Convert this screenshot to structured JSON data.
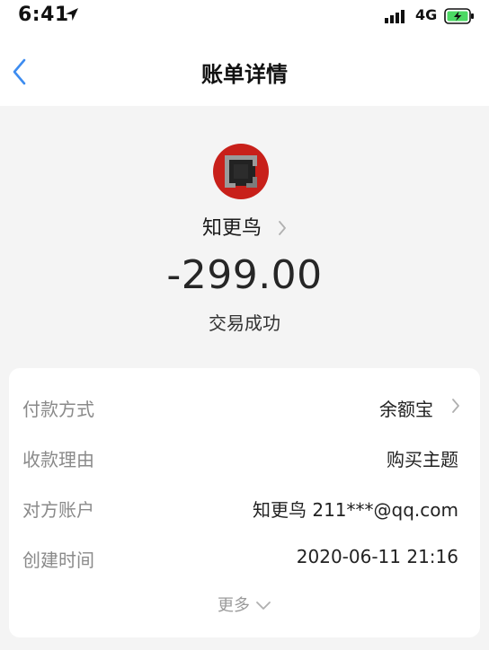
{
  "status_bar": {
    "time": "6:41",
    "network": "4G"
  },
  "nav": {
    "title": "账单详情"
  },
  "transaction": {
    "merchant": "知更鸟",
    "amount": "-299.00",
    "status": "交易成功"
  },
  "details": {
    "rows": [
      {
        "label": "付款方式",
        "value": "余额宝"
      },
      {
        "label": "收款理由",
        "value": "购买主题"
      },
      {
        "label": "对方账户",
        "value": "知更鸟 211***@qq.com"
      },
      {
        "label": "创建时间",
        "value": "2020-06-11 21:16"
      }
    ],
    "more": "更多"
  },
  "colors": {
    "accent": "#3d8cf0",
    "battery_fill": "#4cd964",
    "avatar_red": "#c8201a"
  }
}
